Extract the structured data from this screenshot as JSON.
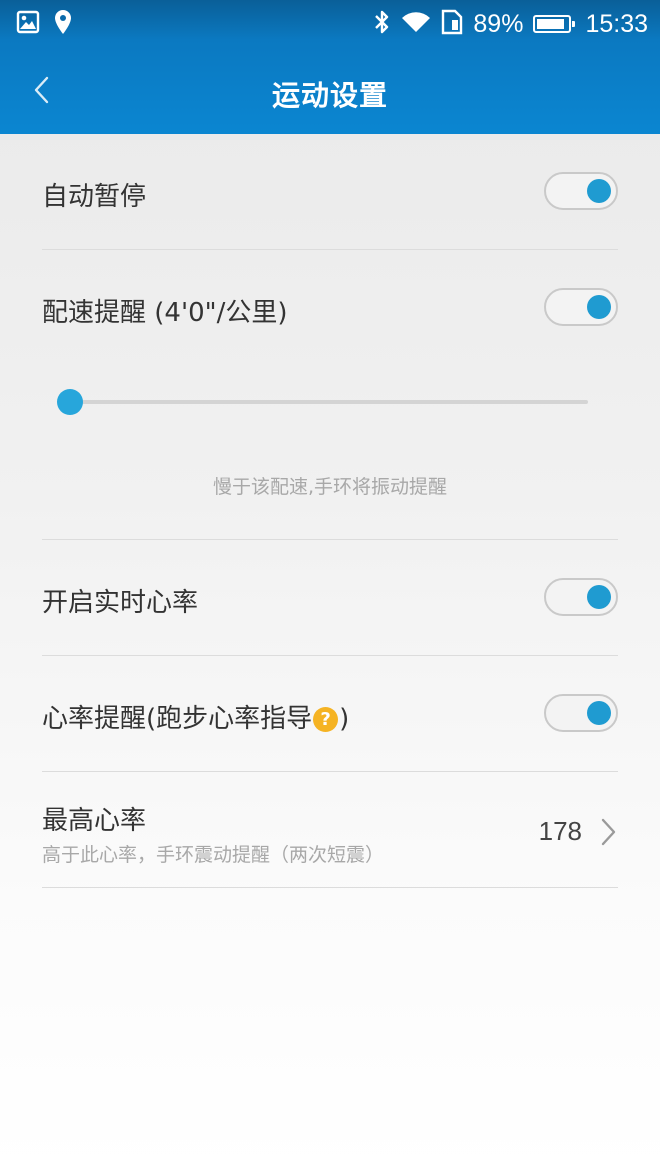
{
  "status_bar": {
    "left_icons": [
      "image-icon",
      "location-pin-icon"
    ],
    "right_icons": [
      "bluetooth-icon",
      "wifi-icon",
      "sim-icon",
      "battery-icon"
    ],
    "battery_percent_text": "89%",
    "battery_level": 0.89,
    "time": "15:33"
  },
  "header": {
    "title": "运动设置",
    "back_icon": "chevron-left-icon"
  },
  "colors": {
    "header_blue": "#0b86d1",
    "toggle_on": "#1f9bd1",
    "slider_knob": "#27a6db",
    "help_icon": "#f5b323"
  },
  "settings": {
    "auto_pause": {
      "label": "自动暂停",
      "enabled": true
    },
    "pace_alert": {
      "label": "配速提醒 (4'0\"/公里)",
      "enabled": true,
      "slider_level": 0,
      "hint": "慢于该配速,手环将振动提醒"
    },
    "realtime_hr": {
      "label": "开启实时心率",
      "enabled": true
    },
    "hr_alert": {
      "label_prefix": "心率提醒(跑步心率指导",
      "help_icon_text": "?",
      "label_suffix": ")",
      "enabled": true
    },
    "max_hr": {
      "label": "最高心率",
      "subtitle": "高于此心率，手环震动提醒（两次短震）",
      "value": "178"
    }
  }
}
